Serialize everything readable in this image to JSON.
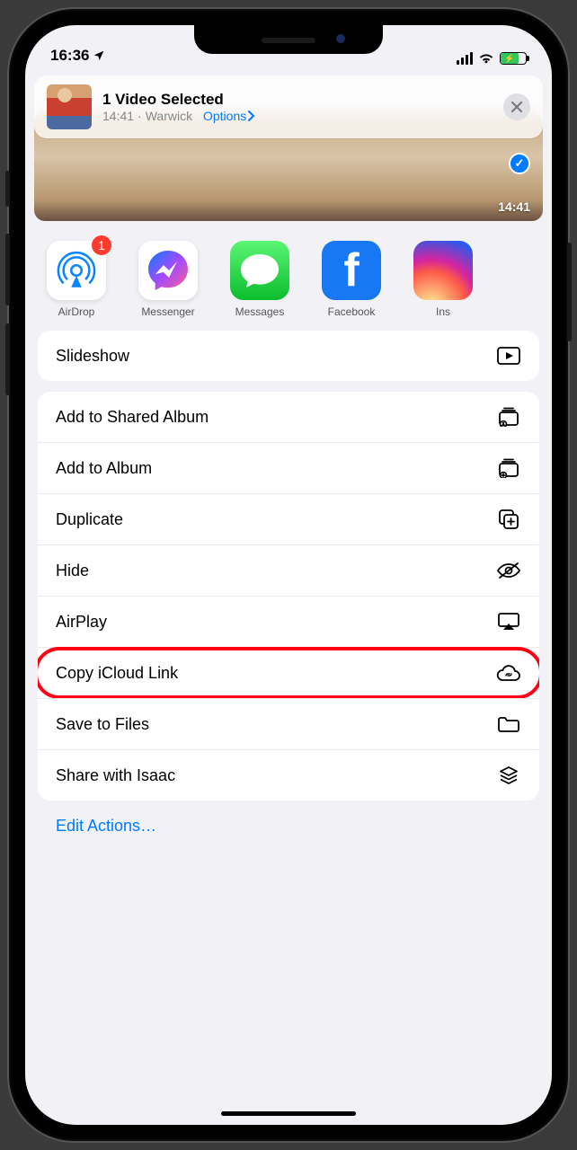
{
  "status": {
    "time": "16:36"
  },
  "header": {
    "title": "1 Video Selected",
    "subtime": "14:41",
    "location": "Warwick",
    "options_label": "Options"
  },
  "preview": {
    "selected_time": "14:41"
  },
  "share_targets": [
    {
      "name": "airdrop",
      "label": "AirDrop",
      "badge": "1"
    },
    {
      "name": "messenger",
      "label": "Messenger"
    },
    {
      "name": "messages",
      "label": "Messages"
    },
    {
      "name": "facebook",
      "label": "Facebook"
    },
    {
      "name": "instagram",
      "label": "Ins"
    }
  ],
  "actions_group1": [
    {
      "label": "Slideshow",
      "icon": "play-rect"
    }
  ],
  "actions_group2": [
    {
      "label": "Add to Shared Album",
      "icon": "shared-album"
    },
    {
      "label": "Add to Album",
      "icon": "add-album"
    },
    {
      "label": "Duplicate",
      "icon": "duplicate"
    },
    {
      "label": "Hide",
      "icon": "eye-slash"
    },
    {
      "label": "AirPlay",
      "icon": "airplay"
    },
    {
      "label": "Copy iCloud Link",
      "icon": "cloud-link",
      "highlight": true
    },
    {
      "label": "Save to Files",
      "icon": "folder"
    },
    {
      "label": "Share with Isaac",
      "icon": "stack"
    }
  ],
  "edit_actions_label": "Edit Actions…"
}
